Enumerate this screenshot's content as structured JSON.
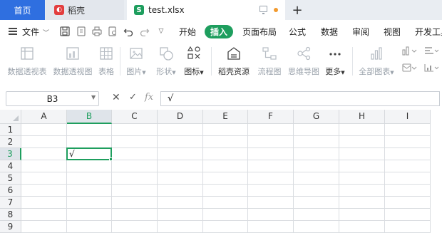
{
  "tabs": {
    "home": "首页",
    "docer": "稻壳",
    "file": "test.xlsx",
    "new_tab": "+"
  },
  "menu": {
    "file": "文件",
    "items": [
      "开始",
      "插入",
      "页面布局",
      "公式",
      "数据",
      "审阅",
      "视图",
      "开发工具"
    ],
    "active": "插入"
  },
  "ribbon": {
    "buttons": [
      {
        "label": "数据透视表",
        "icon": "pivot-table-icon"
      },
      {
        "label": "数据透视图",
        "icon": "pivot-chart-icon"
      },
      {
        "label": "表格",
        "icon": "table-icon"
      },
      {
        "label": "图片",
        "icon": "picture-icon",
        "dropdown": true
      },
      {
        "label": "形状",
        "icon": "shape-icon",
        "dropdown": true
      },
      {
        "label": "图标",
        "icon": "icons-icon",
        "dropdown": true
      },
      {
        "label": "稻壳资源",
        "icon": "docer-resource-icon"
      },
      {
        "label": "流程图",
        "icon": "flowchart-icon"
      },
      {
        "label": "思维导图",
        "icon": "mindmap-icon"
      },
      {
        "label": "更多",
        "icon": "more-icon",
        "dropdown": true
      },
      {
        "label": "全部图表",
        "icon": "all-charts-icon",
        "dropdown": true
      }
    ]
  },
  "formula_bar": {
    "name_box": "B3",
    "cancel": "✕",
    "enter": "✓",
    "fx": "fx",
    "content": "√"
  },
  "sheet": {
    "columns": [
      "A",
      "B",
      "C",
      "D",
      "E",
      "F",
      "G",
      "H",
      "I"
    ],
    "rows": [
      "1",
      "2",
      "3",
      "4",
      "5",
      "6",
      "7",
      "8",
      "9"
    ],
    "selected_column": "B",
    "selected_row": "3",
    "cells": {
      "B3": "√"
    }
  },
  "colors": {
    "accent": "#1e9e5e",
    "home_tab": "#2f6fe0",
    "docer_logo": "#e33e3e",
    "unsaved_dot": "#f29a2e"
  }
}
